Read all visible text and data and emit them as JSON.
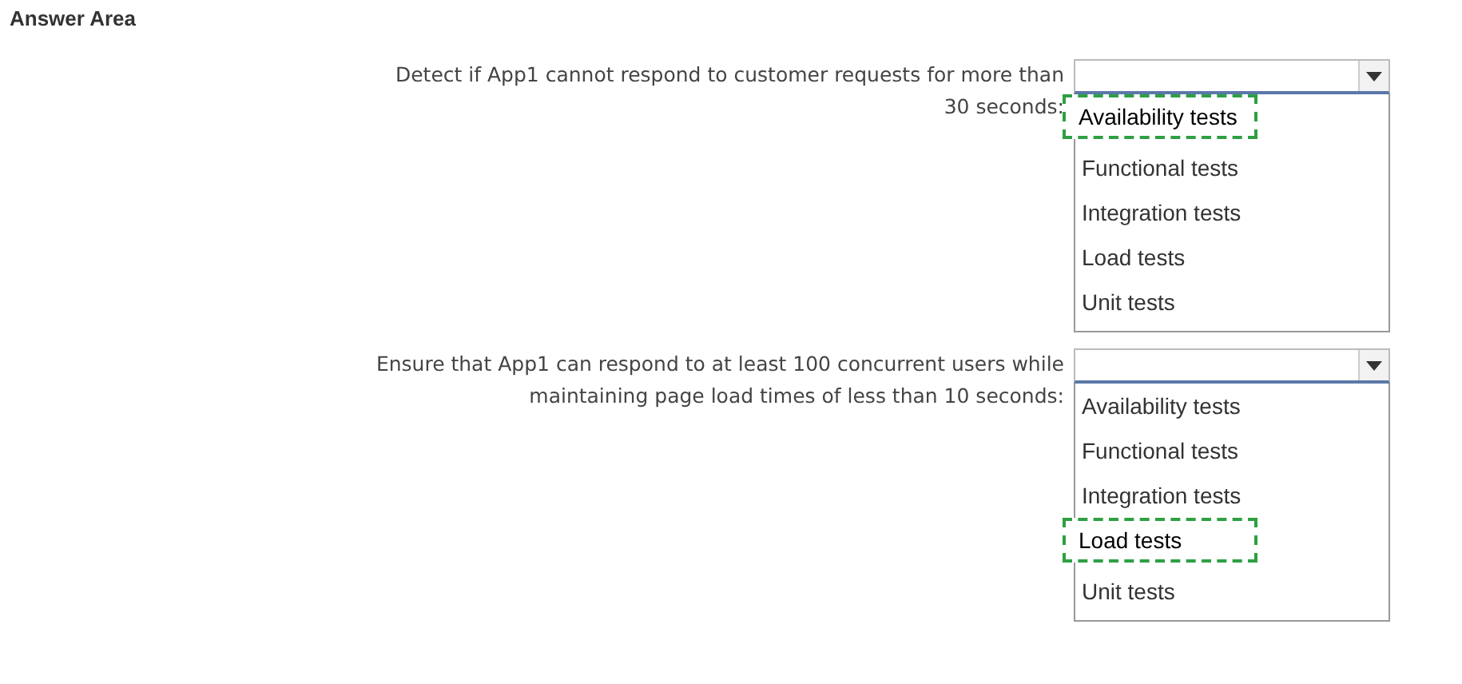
{
  "heading": "Answer Area",
  "questions": [
    {
      "prompt_lines": [
        "Detect if App1 cannot respond to customer requests for more than",
        "30 seconds:"
      ],
      "options": [
        {
          "label": "Availability tests",
          "selected": true
        },
        {
          "label": "Functional tests",
          "selected": false
        },
        {
          "label": "Integration tests",
          "selected": false
        },
        {
          "label": "Load tests",
          "selected": false
        },
        {
          "label": "Unit tests",
          "selected": false
        }
      ]
    },
    {
      "prompt_lines": [
        "Ensure that App1 can respond to at least 100 concurrent users while",
        "maintaining page load times of less than 10 seconds:"
      ],
      "options": [
        {
          "label": "Availability tests",
          "selected": false
        },
        {
          "label": "Functional tests",
          "selected": false
        },
        {
          "label": "Integration tests",
          "selected": false
        },
        {
          "label": "Load tests",
          "selected": true
        },
        {
          "label": "Unit tests",
          "selected": false
        }
      ]
    }
  ]
}
